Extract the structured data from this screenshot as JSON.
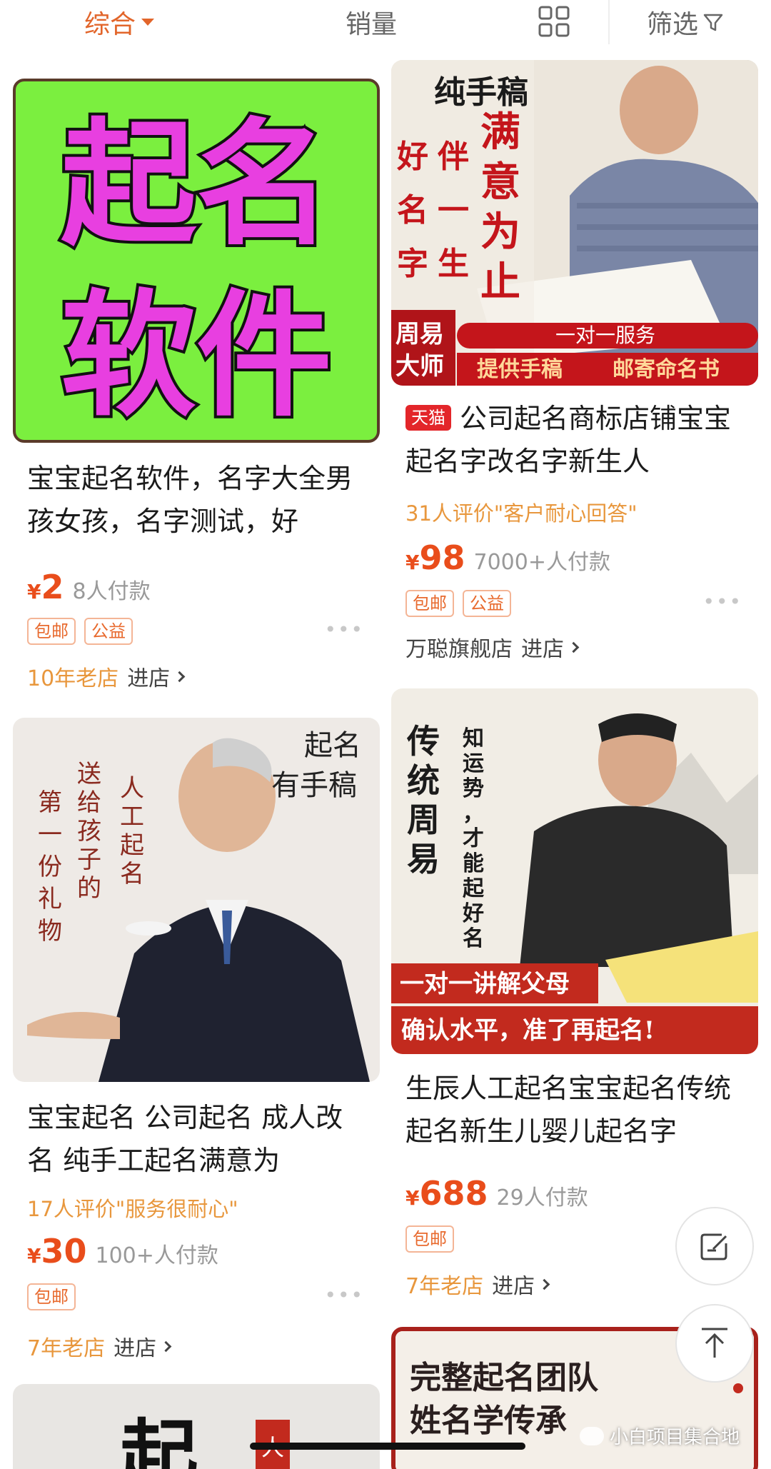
{
  "topbar": {
    "sort_label": "综合",
    "sales_label": "销量",
    "filter_label": "筛选"
  },
  "products": [
    {
      "image_text": [
        "起名",
        "软件"
      ],
      "title": "宝宝起名软件，名字大全男孩女孩，名字测试，好",
      "price_symbol": "¥",
      "price": "2",
      "sold": "8人付款",
      "tags": [
        "包邮",
        "公益"
      ],
      "shop_age": "10年老店",
      "shop_link": "进店"
    },
    {
      "image_text": [
        "纯手稿",
        "满意为止",
        "好名字",
        "伴一生",
        "周易大师",
        "一对一服务",
        "提供手稿",
        "邮寄命名书"
      ],
      "badge": "天猫",
      "title": "公司起名商标店铺宝宝起名字改名字新生人",
      "review": "31人评价\"客户耐心回答\"",
      "price_symbol": "¥",
      "price": "98",
      "sold": "7000+人付款",
      "tags": [
        "包邮",
        "公益"
      ],
      "shop_name": "万聪旗舰店",
      "shop_link": "进店"
    },
    {
      "image_text": [
        "起名",
        "有手稿",
        "送给孩子的",
        "第一份礼物",
        "人工起名"
      ],
      "title": "宝宝起名  公司起名 成人改名 纯手工起名满意为",
      "review": "17人评价\"服务很耐心\"",
      "price_symbol": "¥",
      "price": "30",
      "sold": "100+人付款",
      "tags": [
        "包邮"
      ],
      "shop_age": "7年老店",
      "shop_link": "进店"
    },
    {
      "image_text": [
        "传统周易",
        "知运势，才能起好名",
        "一对一讲解父母",
        "确认水平，准了再起名!"
      ],
      "title": "生辰人工起名宝宝起名传统起名新生儿婴儿起名字",
      "price_symbol": "¥",
      "price": "688",
      "sold": "29人付款",
      "tags": [
        "包邮"
      ],
      "shop_age": "7年老店",
      "shop_link": "进店"
    },
    {
      "image_text": [
        "完整起名团队",
        "姓名学传承"
      ]
    },
    {
      "image_text": [
        "起",
        "人"
      ]
    }
  ],
  "watermark": "小白项目集合地",
  "colors": {
    "accent": "#e2652a",
    "price": "#e94d1b",
    "review": "#e8973d",
    "tmall": "#e3262a"
  }
}
